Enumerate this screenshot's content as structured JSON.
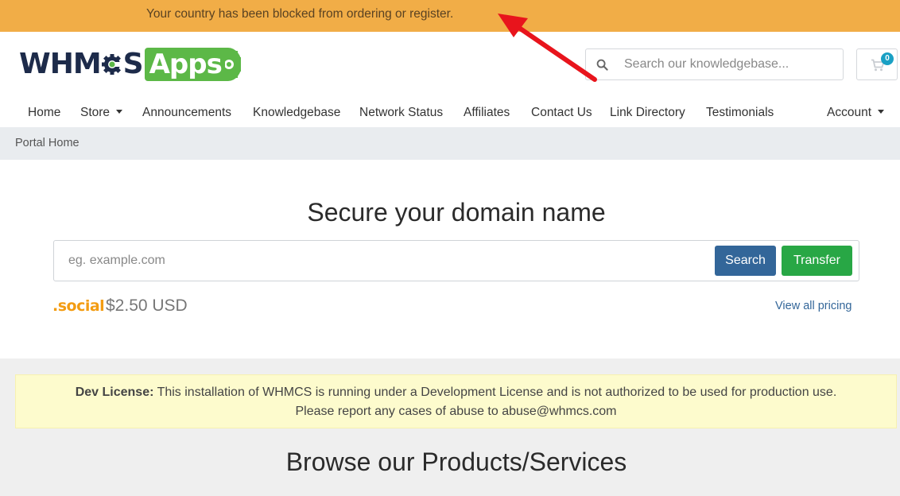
{
  "alert": {
    "text": "Your country has been blocked from ordering or register."
  },
  "header": {
    "logo": {
      "part1": "WHM",
      "part2": "S",
      "part3": "Apps"
    },
    "search": {
      "placeholder": "Search our knowledgebase..."
    },
    "cart": {
      "count": "0"
    }
  },
  "nav": {
    "items": [
      {
        "label": "Home"
      },
      {
        "label": "Store"
      },
      {
        "label": "Announcements"
      },
      {
        "label": "Knowledgebase"
      },
      {
        "label": "Network Status"
      },
      {
        "label": "Affiliates"
      },
      {
        "label": "Contact Us"
      },
      {
        "label": "Link Directory"
      },
      {
        "label": "Testimonials"
      }
    ],
    "account": "Account"
  },
  "breadcrumb": {
    "label": "Portal Home"
  },
  "domain": {
    "title": "Secure your domain name",
    "placeholder": "eg. example.com",
    "search_label": "Search",
    "transfer_label": "Transfer",
    "tld": ".social",
    "tld_price": "$2.50 USD",
    "view_pricing": "View all pricing"
  },
  "dev_license": {
    "label": "Dev License:",
    "line1": "This installation of WHMCS is running under a Development License and is not authorized to be used for production use.",
    "line2": "Please report any cases of abuse to abuse@whmcs.com"
  },
  "browse": {
    "title": "Browse our Products/Services"
  },
  "colors": {
    "alert_bg": "#f1ad47",
    "logo_dark": "#1d2b4a",
    "logo_green": "#5cb847",
    "primary": "#336699",
    "success": "#28a745",
    "badge": "#1aa0c4",
    "tld": "#f39c12",
    "annotation_arrow": "#e8141c"
  },
  "icons": {
    "search": "search-icon",
    "cart": "cart-icon",
    "gear": "gear-icon"
  }
}
